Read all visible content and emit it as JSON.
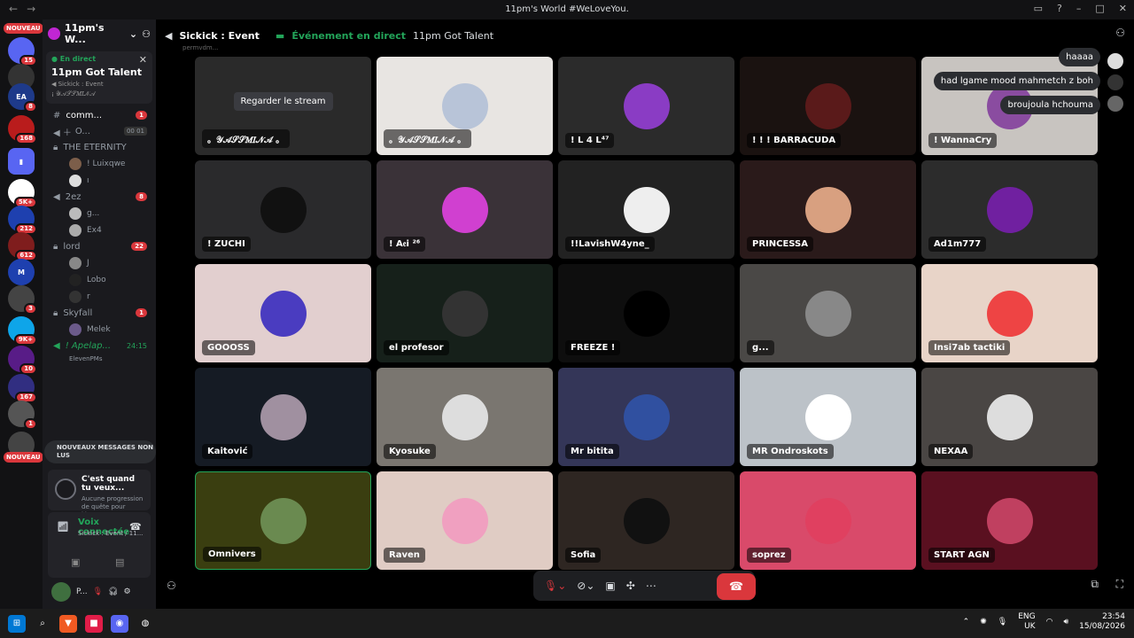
{
  "window": {
    "title": "11pm's World #WeLoveYou.",
    "back": "←",
    "forward": "→"
  },
  "guilds": {
    "new_top": "NOUVEAU",
    "new_bottom": "NOUVEAU",
    "badges": [
      "15",
      "93",
      "8",
      "168",
      "5K+",
      "212",
      "612",
      "3",
      "9K+",
      "10",
      "167",
      "1"
    ]
  },
  "server": {
    "name": "11pm's W...",
    "invite_icon": "person-add"
  },
  "live_card": {
    "tag": "En direct",
    "title": "11pm Got Talent",
    "channel": "Sickick : Event",
    "host": "¡ 𝒴𝒜𝒮𝒮𝑀𝐼𝒩𝒜"
  },
  "channels": [
    {
      "name": "comm...",
      "count": "1"
    },
    {
      "name": "O...",
      "count": ""
    },
    {
      "name": "THE ETERNITY",
      "count": ""
    },
    {
      "name": "2ez",
      "count": "8"
    },
    {
      "name": "lord",
      "count": "22"
    },
    {
      "name": "Skyfall",
      "count": "1"
    },
    {
      "name": "! Apelap...",
      "count": "24:15"
    }
  ],
  "eternity_users": [
    "! Luixqwe",
    "ı"
  ],
  "ez_users": [
    "g...",
    "Ex4"
  ],
  "lord_users": [
    "J",
    "Lobo",
    "r"
  ],
  "skyfall_users": [
    "Melek"
  ],
  "apelapato": {
    "sub": "ElevenPMs",
    "next": "! Apelapato"
  },
  "new_messages": "NOUVEAUX MESSAGES NON LUS",
  "quest": {
    "title": "C'est quand tu veux...",
    "sub": "Aucune progression de quête pour l'instant"
  },
  "voice": {
    "status": "Voix connectée",
    "channel": "Sickick : Event / 11..."
  },
  "user": {
    "name": "P..."
  },
  "header": {
    "channel": "Sickick : Event",
    "event": "Événement en direct",
    "event_name": "11pm Got Talent",
    "sub": "permvdm..."
  },
  "stream_button": "Regarder le stream",
  "tiles": [
    "。𝒴𝒜𝒮𝒮𝑀𝐼𝒩𝒜 。",
    "。𝒴𝒜𝒮𝒮𝑀𝐼𝒩𝒜 。",
    "! L 4 L⁴⁷",
    "! ! ! BARRACUDA",
    "! WannaCry",
    "! ZUCHI",
    "! A𝔢i ²⁶",
    "!!LavishW4yne_",
    "PRINCESSA",
    "Ad1m777",
    "GOOOSS",
    "el profesor",
    "FREEZE !",
    "g...",
    "Insi7ab tactiki",
    "Kaitović",
    "Kyosuke",
    "Mr bitita",
    "MR Ondroskots",
    "NEXAA",
    "Omnivers",
    "Raven",
    "Sofia",
    "soprez",
    "START AGN"
  ],
  "bubbles": [
    "haaaa",
    "had lgame mood mahmetch z boh",
    "broujoula hchouma"
  ],
  "taskbar": {
    "lang1": "ENG",
    "lang2": "UK",
    "time": "23:54",
    "date": "15/08/2026"
  }
}
